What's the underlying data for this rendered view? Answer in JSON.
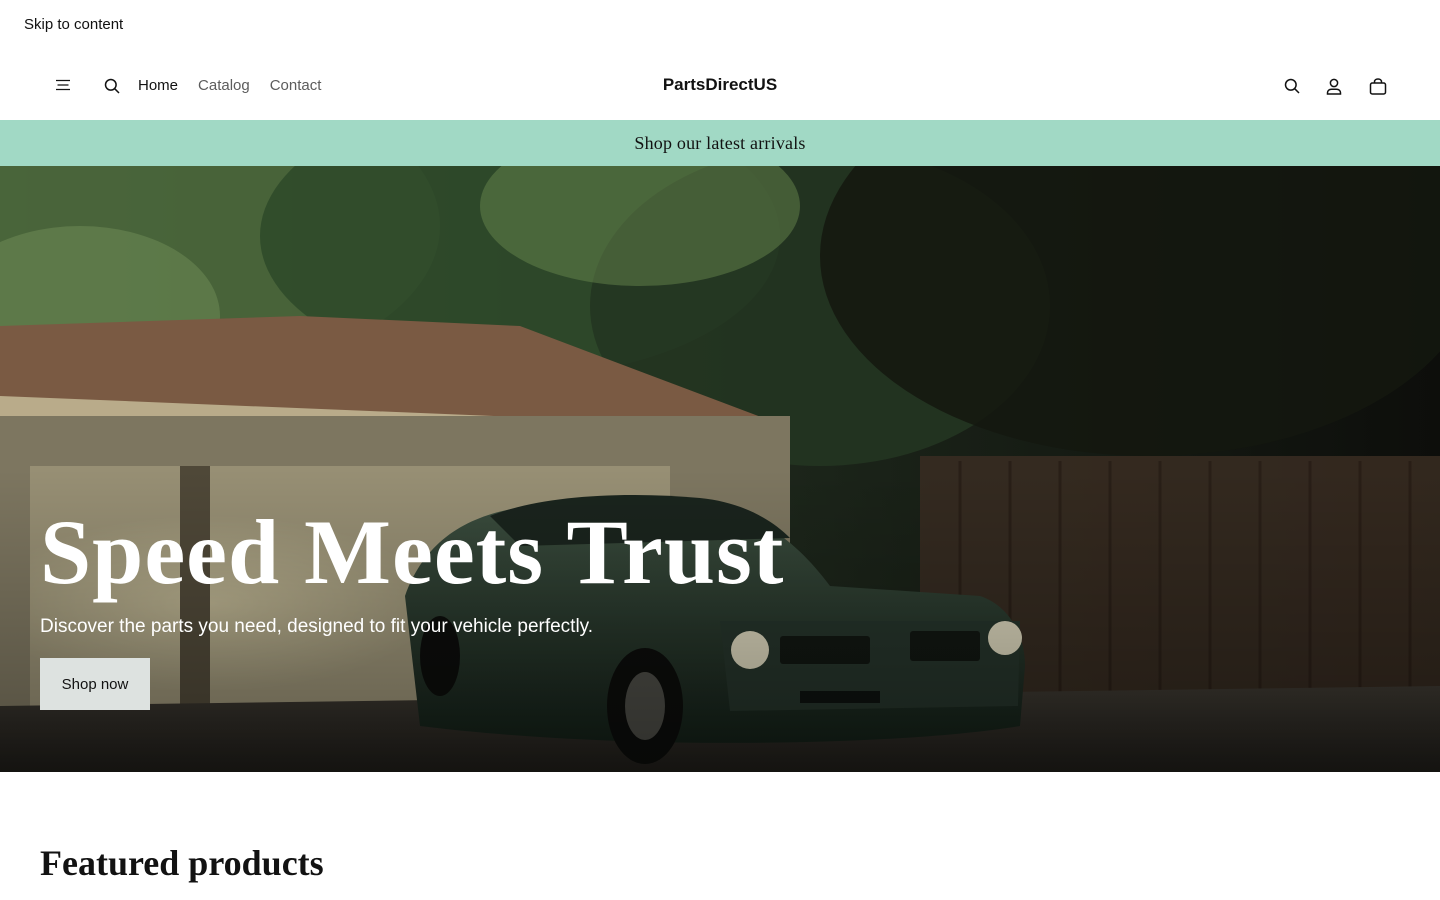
{
  "skip_link": "Skip to content",
  "header": {
    "menu_icon": "hamburger-menu-icon",
    "search_icon_left": "search-icon",
    "nav": [
      {
        "label": "Home",
        "active": true
      },
      {
        "label": "Catalog",
        "active": false
      },
      {
        "label": "Contact",
        "active": false
      }
    ],
    "logo": "PartsDirectUS",
    "right_icons": [
      "search-icon",
      "account-icon",
      "cart-bag-icon"
    ]
  },
  "announcement": {
    "text": "Shop our latest arrivals",
    "bg_color": "#a1d9c5"
  },
  "hero": {
    "title": "Speed Meets Trust",
    "subtitle": "Discover the parts you need, designed to fit your vehicle perfectly.",
    "button_label": "Shop now",
    "image": "classic-green-muscle-car-in-garage-driveway-photo"
  },
  "featured": {
    "title": "Featured products"
  }
}
